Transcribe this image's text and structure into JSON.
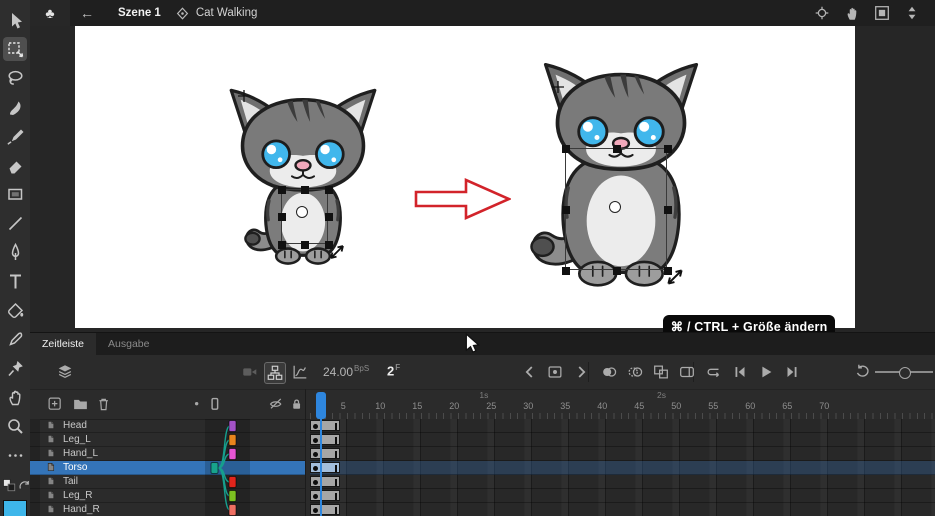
{
  "topbar": {
    "app_icon_glyph": "♣",
    "back_label": "←",
    "scene": "Szene 1",
    "symbol_name": "Cat Walking",
    "right_icons": [
      "center-stage",
      "rotate-view",
      "clip-content-outside-stage",
      "zoom-stepper"
    ]
  },
  "toolbar_tools": [
    "selection",
    "free-transform",
    "lasso",
    "fluid-brush",
    "classic-brush",
    "eraser",
    "rectangle",
    "line",
    "pen",
    "text",
    "paint-bucket",
    "eyedropper",
    "asset-warp",
    "hand",
    "zoom",
    "more"
  ],
  "active_tool": "free-transform",
  "toolbar_fill_color": "#3eb6ea",
  "stage": {
    "tooltip": "⌘ / CTRL + Größe ändern",
    "arrow_color": "#d2232a"
  },
  "timeline": {
    "tabs": [
      {
        "label": "Zeitleiste",
        "active": true
      },
      {
        "label": "Ausgabe",
        "active": false
      }
    ],
    "fps_value": "24.00",
    "fps_unit": "BpS",
    "current_frame": "2",
    "frame_unit": "F",
    "toolbar_icons": [
      "layers-panel",
      "camera",
      "parenting-view",
      "graph-editor",
      "prev-frame",
      "insert-keyframe",
      "next-frame",
      "onion-skin",
      "onion-outline",
      "edit-multiple-frames",
      "frame-flag",
      "loop",
      "step-back",
      "play",
      "step-forward",
      "reset-zoom"
    ],
    "layer_header_icons": [
      "add-layer",
      "new-folder",
      "delete-layer",
      "highlight-dot",
      "parent-column",
      "hide-all",
      "lock-all"
    ],
    "ruler_numbers": [
      5,
      10,
      15,
      20,
      25,
      30,
      35,
      40,
      45,
      50,
      55,
      60,
      65,
      70
    ],
    "second_markers": [
      {
        "label": "1s",
        "frame": 24
      },
      {
        "label": "2s",
        "frame": 48
      }
    ],
    "layers": [
      {
        "name": "Head",
        "color": "#a352c6"
      },
      {
        "name": "Leg_L",
        "color": "#e8851d"
      },
      {
        "name": "Hand_L",
        "color": "#e655d4"
      },
      {
        "name": "Torso",
        "color": "#18a38d",
        "selected": true
      },
      {
        "name": "Tail",
        "color": "#e2251c"
      },
      {
        "name": "Leg_R",
        "color": "#7cc021"
      },
      {
        "name": "Hand_R",
        "color": "#ef6f62"
      }
    ],
    "span_frames": 4,
    "playhead_frame": 2,
    "selection_color": "#3474b8",
    "playhead_color": "#2e86de",
    "parent_wire_color": "#169f8d"
  }
}
